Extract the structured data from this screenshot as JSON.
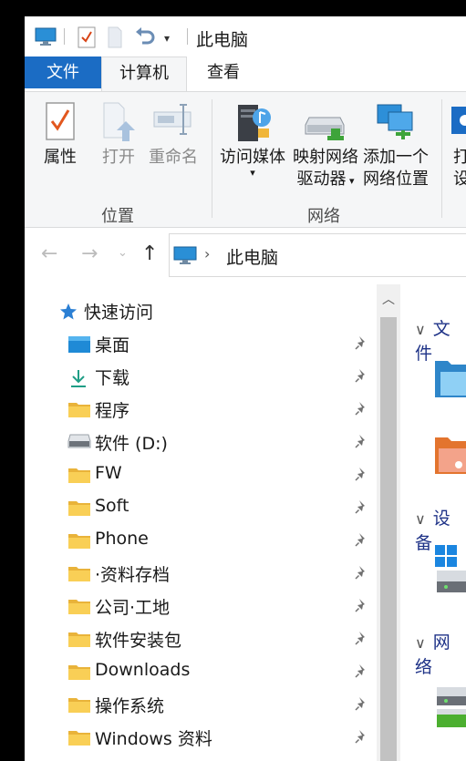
{
  "window": {
    "title": "此电脑"
  },
  "ribbon_tabs": [
    {
      "label": "文件"
    },
    {
      "label": "计算机"
    },
    {
      "label": "查看"
    }
  ],
  "ribbon": {
    "location_group": {
      "label": "位置",
      "buttons": [
        {
          "label": "属性",
          "icon": "properties-icon"
        },
        {
          "label": "打开",
          "icon": "open-icon"
        },
        {
          "label": "重命名",
          "icon": "rename-icon"
        }
      ]
    },
    "network_group": {
      "label": "网络",
      "buttons": [
        {
          "line1": "访问媒体",
          "line2": "",
          "icon": "media-server-icon"
        },
        {
          "line1": "映射网络",
          "line2": "驱动器",
          "icon": "map-drive-icon"
        },
        {
          "line1": "添加一个",
          "line2": "网络位置",
          "icon": "network-location-icon"
        }
      ]
    },
    "partial_group": {
      "line1": "打",
      "line2": "设"
    }
  },
  "address": {
    "path": "此电脑"
  },
  "nav_tree": {
    "quick_access_label": "快速访问",
    "items": [
      {
        "label": "桌面",
        "icon": "desktop-icon"
      },
      {
        "label": "下载",
        "icon": "download-icon"
      },
      {
        "label": "程序",
        "icon": "folder-icon"
      },
      {
        "label": "软件 (D:)",
        "icon": "drive-icon"
      },
      {
        "label": "FW",
        "icon": "folder-icon"
      },
      {
        "label": "Soft",
        "icon": "folder-icon"
      },
      {
        "label": "Phone",
        "icon": "folder-icon"
      },
      {
        "label": "·资料存档",
        "icon": "folder-icon"
      },
      {
        "label": "公司·工地",
        "icon": "folder-icon"
      },
      {
        "label": "软件安装包",
        "icon": "folder-icon"
      },
      {
        "label": "Downloads",
        "icon": "folder-icon"
      },
      {
        "label": "操作系统",
        "icon": "folder-icon"
      },
      {
        "label": "Windows 资料",
        "icon": "folder-icon"
      }
    ]
  },
  "content_sections": [
    {
      "label": "文件"
    },
    {
      "label": "设备"
    },
    {
      "label": "网络"
    }
  ],
  "colors": {
    "accent": "#1b6cc4",
    "folder": "#f7c948",
    "ribbon_bg": "#f5f6f7"
  }
}
